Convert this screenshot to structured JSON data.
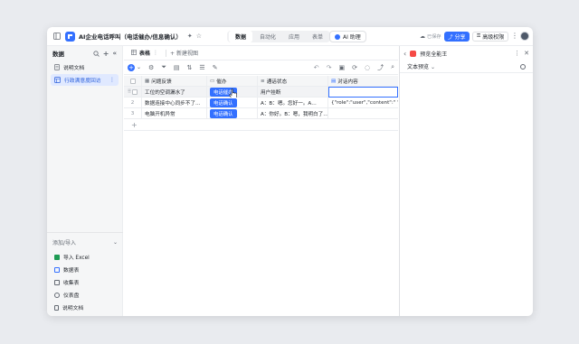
{
  "app": {
    "title": "AI企业电话呼叫（电话催办/信息确认）",
    "tabs": [
      "数据",
      "自动化",
      "应用",
      "表单"
    ],
    "active_tab": "数据",
    "ai_assistant": "AI 助理",
    "saved_status": "已保存",
    "share_label": "分享",
    "permission_label": "高级权限"
  },
  "sidebar": {
    "title": "数据",
    "items": [
      {
        "label": "说明文档",
        "icon": "doc-icon",
        "active": false
      },
      {
        "label": "行政满意度回访",
        "icon": "table-icon",
        "active": true
      }
    ],
    "add_import_label": "添加/导入",
    "import_items": [
      {
        "label": "导入 Excel",
        "icon": "excel-icon"
      },
      {
        "label": "数据表",
        "icon": "table-icon"
      },
      {
        "label": "收集表",
        "icon": "form-icon"
      },
      {
        "label": "仪表盘",
        "icon": "dashboard-icon"
      },
      {
        "label": "说明文档",
        "icon": "doc-icon"
      }
    ]
  },
  "view": {
    "tab_label": "表格",
    "new_view_label": "+ 新建视图"
  },
  "table": {
    "columns": [
      "问题反馈",
      "催办",
      "通话状态",
      "对话内容"
    ],
    "rows": [
      {
        "num": "1",
        "feedback": "工位的空调漏水了",
        "button": "电话催办",
        "status": "用户挂断",
        "content": ""
      },
      {
        "num": "2",
        "feedback": "数据连接中心同步不了…",
        "button": "电话确认",
        "status": "A：B：嗯。您好一。A…",
        "content": "{\"role\":\"user\",\"content\":\" \"…"
      },
      {
        "num": "3",
        "feedback": "电脑开机异常",
        "button": "电话确认",
        "status": "A：你好。B：嗯，我明白了…",
        "content": ""
      }
    ],
    "add_row": "+"
  },
  "preview": {
    "title": "预览全能王",
    "mode_label": "文本预览"
  },
  "colors": {
    "accent": "#3370ff",
    "sidebar_active_bg": "#e0e9ff"
  }
}
